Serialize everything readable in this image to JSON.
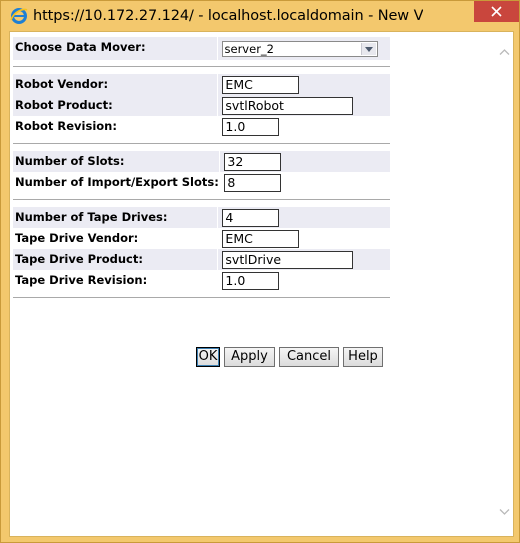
{
  "window": {
    "title": "https://10.172.27.124/ - localhost.localdomain - New V..."
  },
  "form": {
    "data_mover": {
      "label": "Choose Data Mover:",
      "value": "server_2"
    },
    "robot_vendor": {
      "label": "Robot Vendor:",
      "value": "EMC"
    },
    "robot_product": {
      "label": "Robot Product:",
      "value": "svtlRobot"
    },
    "robot_revision": {
      "label": "Robot Revision:",
      "value": "1.0"
    },
    "num_slots": {
      "label": "Number of Slots:",
      "value": "32"
    },
    "num_ie_slots": {
      "label": "Number of Import/Export Slots:",
      "value": "8"
    },
    "num_tape_drives": {
      "label": "Number of Tape Drives:",
      "value": "4"
    },
    "tape_vendor": {
      "label": "Tape Drive Vendor:",
      "value": "EMC"
    },
    "tape_product": {
      "label": "Tape Drive Product:",
      "value": "svtlDrive"
    },
    "tape_revision": {
      "label": "Tape Drive Revision:",
      "value": "1.0"
    }
  },
  "buttons": {
    "ok": "OK",
    "apply": "Apply",
    "cancel": "Cancel",
    "help": "Help"
  },
  "colors": {
    "frame": "#f3c86d",
    "row_shade": "#ebebf3",
    "close_button": "#c9463d"
  }
}
